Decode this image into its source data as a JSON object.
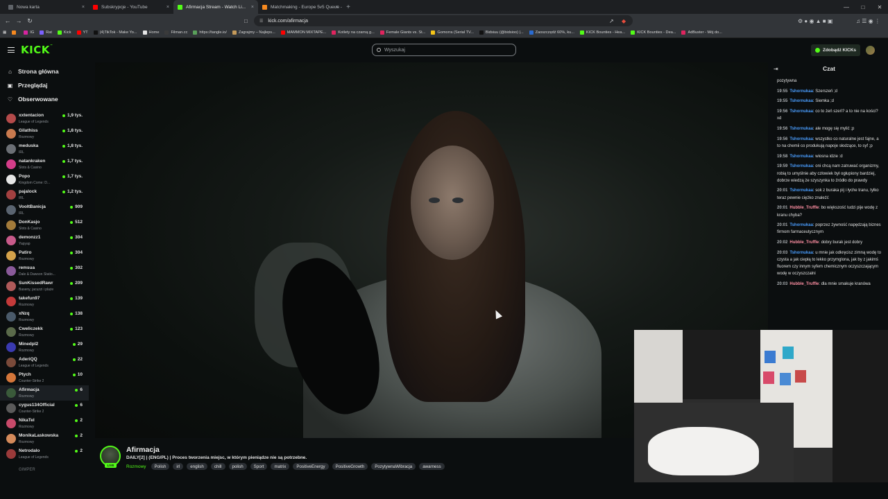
{
  "browser": {
    "tabs": [
      {
        "label": "Nowa karta",
        "color": "#5f6368",
        "active": false
      },
      {
        "label": "Subskrypcje - YouTube",
        "color": "#ff0000",
        "active": false
      },
      {
        "label": "Afirmacja Stream - Watch Li...",
        "color": "#53fc18",
        "active": true
      },
      {
        "label": "Matchmaking - Europe 5v5 Queue -",
        "color": "#f6891f",
        "active": false
      }
    ],
    "url": "kick.com/afirmacja",
    "bookmarks": [
      {
        "label": "",
        "color": "#f6891f"
      },
      {
        "label": "IG",
        "color": "#d6249f"
      },
      {
        "label": "Rat",
        "color": "#7b61ff"
      },
      {
        "label": "Kick",
        "color": "#53fc18"
      },
      {
        "label": "YT",
        "color": "#ff0000"
      },
      {
        "label": "(4)TikTok - Make Yo...",
        "color": "#111111"
      },
      {
        "label": "Home",
        "color": "#e6e6e6"
      },
      {
        "label": "Filman.cc",
        "color": "#3a3a3a"
      },
      {
        "label": "https://tangle.io/",
        "color": "#5aa05a"
      },
      {
        "label": "Zagrajmy – Najleps...",
        "color": "#c59a5a"
      },
      {
        "label": "MAMMON MIXTAPE...",
        "color": "#ff0000"
      },
      {
        "label": "Kotlety na czarną g...",
        "color": "#e0245e"
      },
      {
        "label": "Female Giants vs. St...",
        "color": "#e0245e"
      },
      {
        "label": "Gomorra (Serial TV...",
        "color": "#f5c518"
      },
      {
        "label": "Bidsiuu (@bidsioo) |...",
        "color": "#111111"
      },
      {
        "label": "Zaoszczędź 60%, ku...",
        "color": "#2a6bd1"
      },
      {
        "label": "KICK Bounties - Hea...",
        "color": "#53fc18"
      },
      {
        "label": "KICK Bounties - Dea...",
        "color": "#53fc18"
      },
      {
        "label": "AdBuster - Mój do...",
        "color": "#e0245e"
      }
    ]
  },
  "header": {
    "logo": "KICK",
    "search_placeholder": "Wyszukaj",
    "kicks_button": "Zdobądź KICKs"
  },
  "sidebar": {
    "nav": [
      {
        "label": "Strona główna",
        "icon": "home-icon"
      },
      {
        "label": "Przeglądaj",
        "icon": "compass-icon"
      },
      {
        "label": "Obserwowane",
        "icon": "heart-icon"
      }
    ],
    "channels": [
      {
        "name": "xxtentacion",
        "category": "League of Legends",
        "viewers": "1,9 tys.",
        "color": "#b44a4a"
      },
      {
        "name": "Gilathiss",
        "category": "Rozmowy",
        "viewers": "1,8 tys.",
        "color": "#c97a4e"
      },
      {
        "name": "meduska",
        "category": "IRL",
        "viewers": "1,8 tys.",
        "color": "#6b6f75"
      },
      {
        "name": "natankraken",
        "category": "Slots & Casino",
        "viewers": "1,7 tys.",
        "color": "#d43d8a"
      },
      {
        "name": "Popo",
        "category": "Kingdom Come: D...",
        "viewers": "1,7 tys.",
        "color": "#e6e6e6"
      },
      {
        "name": "pajalock",
        "category": "IRL",
        "viewers": "1,2 tys.",
        "color": "#a34040"
      },
      {
        "name": "VooltBanicja",
        "category": "IRL",
        "viewers": "909",
        "color": "#5a6470"
      },
      {
        "name": "DonKasjo",
        "category": "Slots & Casino",
        "viewers": "512",
        "color": "#a37b3a"
      },
      {
        "name": "demonzz1",
        "category": "Yapyap",
        "viewers": "304",
        "color": "#c85a8a"
      },
      {
        "name": "Patiro",
        "category": "Rozmowy",
        "viewers": "304",
        "color": "#d4a24a"
      },
      {
        "name": "remsua",
        "category": "Dale & Dawson Statio...",
        "viewers": "302",
        "color": "#8a5a9a"
      },
      {
        "name": "SunKissedRawr",
        "category": "Baseny, jacuzzi i plaże",
        "viewers": "209",
        "color": "#b05a5a"
      },
      {
        "name": "takefun97",
        "category": "Rozmowy",
        "viewers": "139",
        "color": "#c43a3a"
      },
      {
        "name": "xNzq",
        "category": "Rozmowy",
        "viewers": "138",
        "color": "#4a5a6a"
      },
      {
        "name": "Cweliczekk",
        "category": "Rozmowy",
        "viewers": "123",
        "color": "#5a6a4a"
      },
      {
        "name": "Minedpl2",
        "category": "Rozmowy",
        "viewers": "29",
        "color": "#3a3ab0"
      },
      {
        "name": "AderiQQ",
        "category": "League of Legends",
        "viewers": "22",
        "color": "#7a4a3a"
      },
      {
        "name": "Ptych",
        "category": "Counter-Strike 2",
        "viewers": "10",
        "color": "#d4763a"
      },
      {
        "name": "Afirmacja",
        "category": "Rozmowy",
        "viewers": "6",
        "color": "#3a5a3a",
        "active": true
      },
      {
        "name": "cygus134Official",
        "category": "Counter-Strike 2",
        "viewers": "6",
        "color": "#5a5a5a"
      },
      {
        "name": "NikaTel",
        "category": "Rozmowy",
        "viewers": "2",
        "color": "#c84a6a"
      },
      {
        "name": "MonikaLaskowska",
        "category": "Rozmowy",
        "viewers": "2",
        "color": "#d48a5a"
      },
      {
        "name": "Netrodalo",
        "category": "League of Legends",
        "viewers": "2",
        "color": "#9a3a3a"
      }
    ],
    "more": "GIMPER"
  },
  "stream": {
    "name": "Afirmacja",
    "title": "DAILY[2] | (ENG/PL) | Proces tworzenia miejsc, w którym pieniądze nie są potrzebne.",
    "live_badge": "LIVE",
    "category": "Rozmowy",
    "tags": [
      "Polish",
      "irl",
      "english",
      "chill",
      "polish",
      "Sport",
      "matrix",
      "PositiveEnergy",
      "PositiveGrowth",
      "PozytywnaWibracja",
      "awarness"
    ]
  },
  "chat": {
    "title": "Czat",
    "messages": [
      {
        "time": "",
        "user": "",
        "user_color": "#4a9eff",
        "text": "pozytywna"
      },
      {
        "time": "19:55",
        "user": "Tshornukaa",
        "user_color": "#4a9eff",
        "text": "Szerszeń ;d"
      },
      {
        "time": "19:55",
        "user": "Tshornukaa",
        "user_color": "#4a9eff",
        "text": "Siemka ;d"
      },
      {
        "time": "19:56",
        "user": "Tshornukaa",
        "user_color": "#4a9eff",
        "text": "co to żeń szeń? a to nie na kości? xd"
      },
      {
        "time": "19:56",
        "user": "Tshornukaa",
        "user_color": "#4a9eff",
        "text": "ale mogę się mylić ;p"
      },
      {
        "time": "19:56",
        "user": "Tshornukaa",
        "user_color": "#4a9eff",
        "text": "wszystko co naturalne jest fajne, a to na chemii co produkują napoje słodzące, to syf ;p"
      },
      {
        "time": "19:58",
        "user": "Tshornukaa",
        "user_color": "#4a9eff",
        "text": "wiosna idzie :d"
      },
      {
        "time": "19:59",
        "user": "Tshornukaa",
        "user_color": "#4a9eff",
        "text": "oni chcą nam zatruwać organizmy, robią to umyślnie aby człowiek był ogłupiony bardziej, dobrze wiedzą że szyszynka to źródło do prawdy"
      },
      {
        "time": "20:01",
        "user": "Tshornukaa",
        "user_color": "#4a9eff",
        "text": "sok z buraka pij i łyche tranu, tylko teraz pewnie ciężko znaleźć"
      },
      {
        "time": "20:01",
        "user": "Hubble_Truffle",
        "user_color": "#ff8fa3",
        "text": "bo większość ludzi pije wodę z kranu chyba?"
      },
      {
        "time": "20:01",
        "user": "Tshornukaa",
        "user_color": "#4a9eff",
        "text": "poprzez żywność napędzają biznes firmom farmaceutycznym"
      },
      {
        "time": "20:02",
        "user": "Hubble_Truffle",
        "user_color": "#ff8fa3",
        "text": "dobry burak jest dobry"
      },
      {
        "time": "20:03",
        "user": "Tshornukaa",
        "user_color": "#4a9eff",
        "text": "u mnie jak odkręcisz zimną wodę to czysta a jak ciepłą to lekko przymglona, jak by z jakimś fluorem czy innym syfem chemicznym oczyszczającym wodę w oczyszczalni"
      },
      {
        "time": "20:03",
        "user": "Hubble_Truffle",
        "user_color": "#ff8fa3",
        "text": "dla mnie smakuje kranówa"
      }
    ]
  }
}
